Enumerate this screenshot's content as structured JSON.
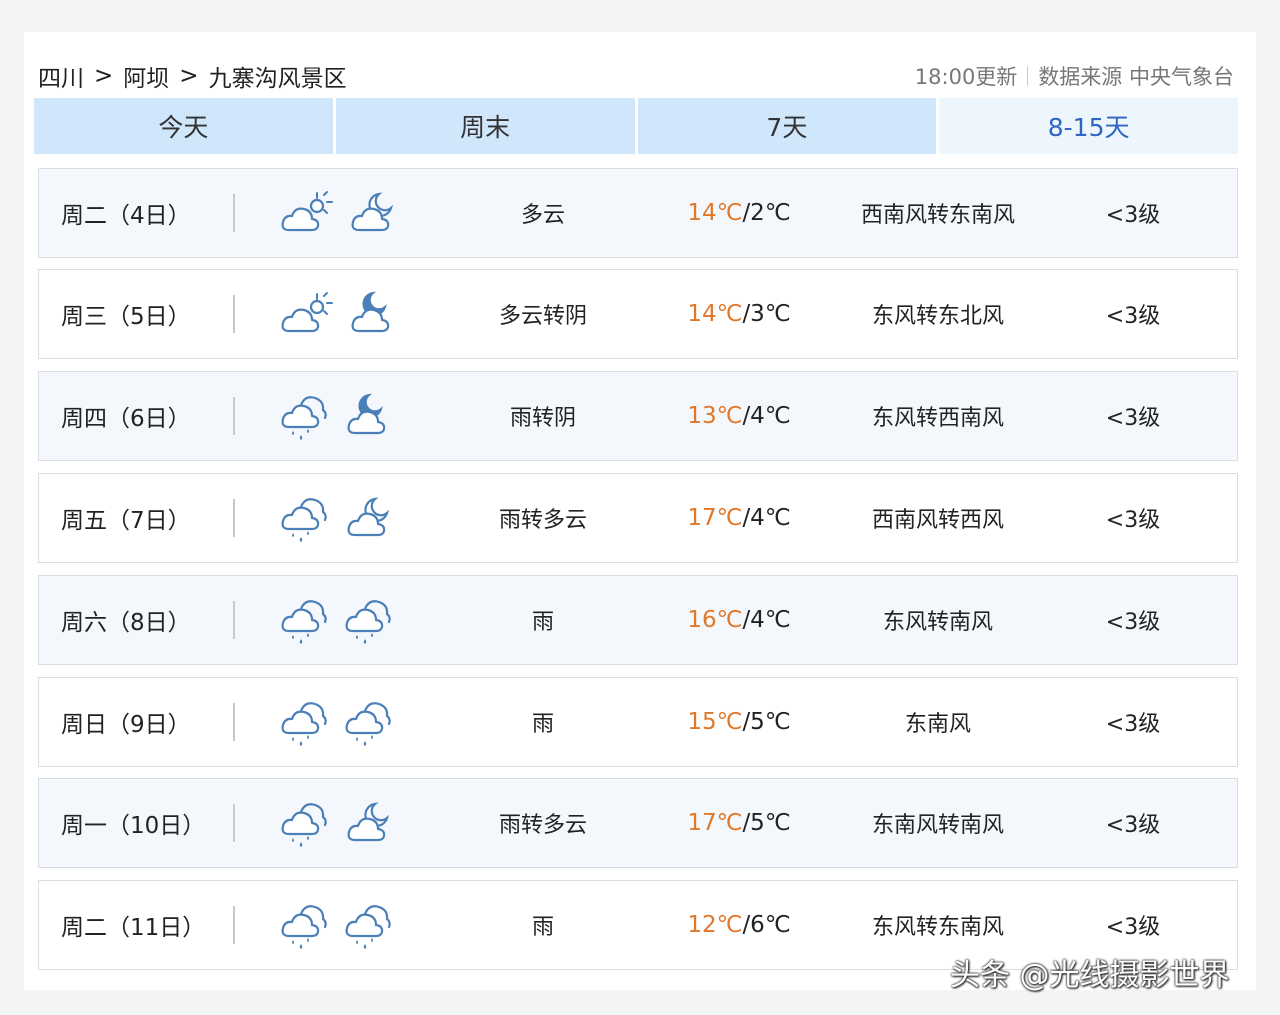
{
  "breadcrumb": [
    "四川",
    "阿坝",
    "九寨沟风景区"
  ],
  "breadcrumb_sep": ">",
  "update_time": "18:00更新",
  "source": "数据来源 中央气象台",
  "tabs": [
    {
      "label": "今天"
    },
    {
      "label": "周末"
    },
    {
      "label": "7天"
    },
    {
      "label": "8-15天",
      "active": true
    }
  ],
  "forecast": [
    {
      "day": "周二（4日）",
      "icon_day": "partly-cloudy-sun-icon",
      "icon_night": "cloudy-moon-icon",
      "condition": "多云",
      "high": "14℃",
      "low": "/2℃",
      "wind": "西南风转东南风",
      "level": "<3级"
    },
    {
      "day": "周三（5日）",
      "icon_day": "partly-cloudy-sun-icon",
      "icon_night": "overcast-moon-icon",
      "condition": "多云转阴",
      "high": "14℃",
      "low": "/3℃",
      "wind": "东风转东北风",
      "level": "<3级"
    },
    {
      "day": "周四（6日）",
      "icon_day": "rain-icon",
      "icon_night": "overcast-moon-icon",
      "condition": "雨转阴",
      "high": "13℃",
      "low": "/4℃",
      "wind": "东风转西南风",
      "level": "<3级"
    },
    {
      "day": "周五（7日）",
      "icon_day": "rain-icon",
      "icon_night": "cloudy-moon-icon",
      "condition": "雨转多云",
      "high": "17℃",
      "low": "/4℃",
      "wind": "西南风转西风",
      "level": "<3级"
    },
    {
      "day": "周六（8日）",
      "icon_day": "rain-icon",
      "icon_night": "rain-icon",
      "condition": "雨",
      "high": "16℃",
      "low": "/4℃",
      "wind": "东风转南风",
      "level": "<3级"
    },
    {
      "day": "周日（9日）",
      "icon_day": "rain-icon",
      "icon_night": "rain-icon",
      "condition": "雨",
      "high": "15℃",
      "low": "/5℃",
      "wind": "东南风",
      "level": "<3级"
    },
    {
      "day": "周一（10日）",
      "icon_day": "rain-icon",
      "icon_night": "cloudy-moon-icon",
      "condition": "雨转多云",
      "high": "17℃",
      "low": "/5℃",
      "wind": "东南风转南风",
      "level": "<3级"
    },
    {
      "day": "周二（11日）",
      "icon_day": "rain-icon",
      "icon_night": "rain-icon",
      "condition": "雨",
      "high": "12℃",
      "low": "/6℃",
      "wind": "东风转东南风",
      "level": "<3级"
    }
  ],
  "colors": {
    "tab_bg": "#cfe6fb",
    "tab_active_text": "#2f66c2",
    "high_temp": "#e0782a",
    "icon_stroke": "#4a7fb8"
  },
  "watermark": "头条 @光线摄影世界"
}
